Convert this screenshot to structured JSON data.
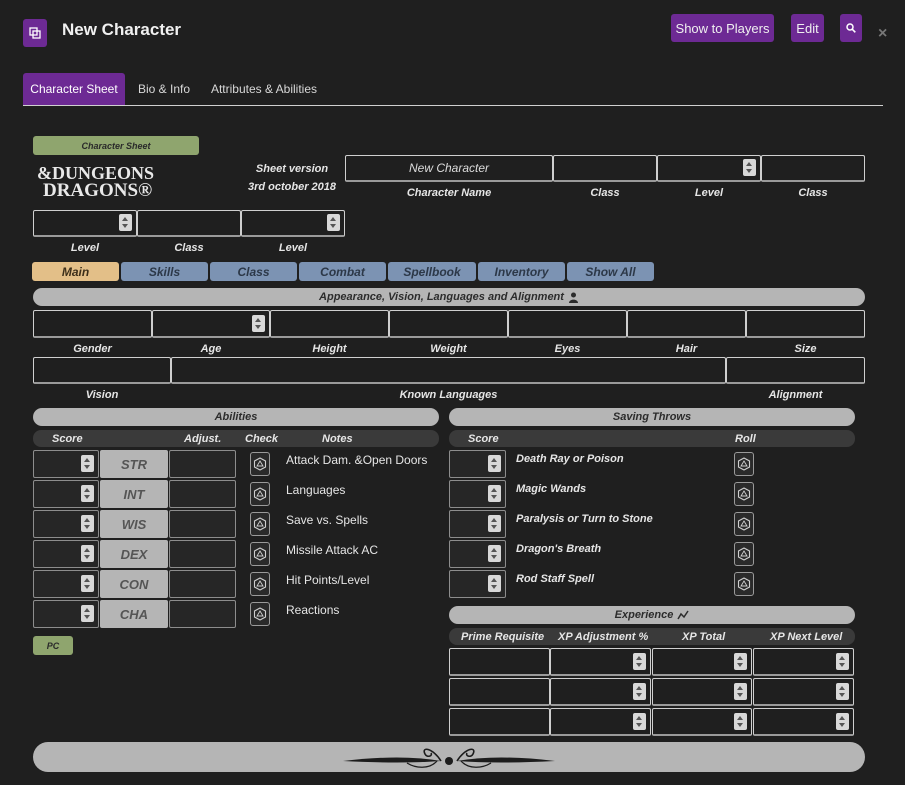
{
  "window": {
    "title": "New Character",
    "buttons": {
      "show_to_players": "Show to Players",
      "edit": "Edit"
    },
    "icons": [
      "popout-icon",
      "search-icon",
      "close-icon"
    ]
  },
  "tabs": [
    {
      "label": "Character Sheet",
      "active": true
    },
    {
      "label": "Bio & Info",
      "active": false
    },
    {
      "label": "Attributes & Abilities",
      "active": false
    }
  ],
  "sheet": {
    "pill": "Character Sheet",
    "logo": {
      "line1": "&DUNGEONS",
      "line2": "DRAGONS®"
    },
    "version_line1": "Sheet version",
    "version_line2": "3rd october 2018",
    "character_name_value": "New Character",
    "labels": {
      "character_name": "Character Name",
      "class1": "Class",
      "level1": "Level",
      "class2": "Class",
      "level2": "Level",
      "class3": "Class",
      "level3": "Level"
    }
  },
  "nav": [
    {
      "label": "Main",
      "active": true
    },
    {
      "label": "Skills",
      "active": false
    },
    {
      "label": "Class",
      "active": false
    },
    {
      "label": "Combat",
      "active": false
    },
    {
      "label": "Spellbook",
      "active": false
    },
    {
      "label": "Inventory",
      "active": false
    },
    {
      "label": "Show All",
      "active": false
    }
  ],
  "appearance": {
    "header": "Appearance, Vision, Languages and Alignment",
    "fields": [
      "Gender",
      "Age",
      "Height",
      "Weight",
      "Eyes",
      "Hair",
      "Size"
    ],
    "row2": {
      "vision": "Vision",
      "languages": "Known Languages",
      "alignment": "Alignment"
    }
  },
  "abilities": {
    "header": "Abilities",
    "columns": {
      "score": "Score",
      "adjust": "Adjust.",
      "check": "Check",
      "notes": "Notes"
    },
    "rows": [
      {
        "stat": "STR",
        "note": "Attack Dam. &Open Doors"
      },
      {
        "stat": "INT",
        "note": "Languages"
      },
      {
        "stat": "WIS",
        "note": "Save vs. Spells"
      },
      {
        "stat": "DEX",
        "note": "Missile Attack AC"
      },
      {
        "stat": "CON",
        "note": "Hit Points/Level"
      },
      {
        "stat": "CHA",
        "note": "Reactions"
      }
    ],
    "pc_pill": "PC"
  },
  "saving_throws": {
    "header": "Saving Throws",
    "columns": {
      "score": "Score",
      "roll": "Roll"
    },
    "rows": [
      "Death Ray or Poison",
      "Magic Wands",
      "Paralysis or Turn to Stone",
      "Dragon's Breath",
      "Rod Staff Spell"
    ]
  },
  "experience": {
    "header": "Experience",
    "columns": [
      "Prime Requisite",
      "XP Adjustment %",
      "XP Total",
      "XP Next Level"
    ]
  },
  "colors": {
    "accent": "#6d2a94",
    "nav_active": "#e3bf88",
    "nav": "#7c93b3",
    "pill_green": "#8fa56e",
    "bar": "#b5b5b5"
  }
}
